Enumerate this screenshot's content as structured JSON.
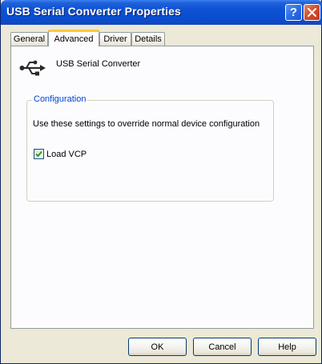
{
  "window": {
    "title": "USB Serial Converter Properties",
    "help_glyph": "?",
    "close_icon": "close-x-icon"
  },
  "tabs": [
    {
      "label": "General",
      "active": false
    },
    {
      "label": "Advanced",
      "active": true
    },
    {
      "label": "Driver",
      "active": false
    },
    {
      "label": "Details",
      "active": false
    }
  ],
  "device": {
    "icon": "usb-icon",
    "name": "USB Serial Converter"
  },
  "configuration": {
    "group_label": "Configuration",
    "description": "Use these settings to override normal device configuration",
    "load_vcp": {
      "label": "Load VCP",
      "checked": true
    }
  },
  "buttons": {
    "ok": "OK",
    "cancel": "Cancel",
    "help": "Help"
  },
  "colors": {
    "titlebar": "#0b4ed0",
    "group_label": "#0046d5",
    "active_tab_accent": "#ffc83c",
    "checkmark": "#21a121"
  }
}
